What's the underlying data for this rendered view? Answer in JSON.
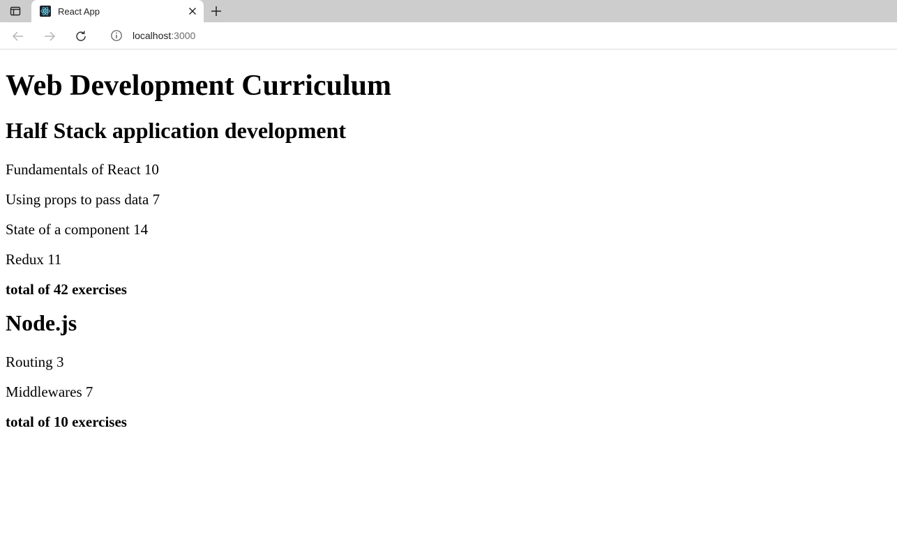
{
  "browser": {
    "tab_title": "React App",
    "url_host": "localhost",
    "url_port": ":3000"
  },
  "page": {
    "title": "Web Development Curriculum",
    "courses": [
      {
        "name": "Half Stack application development",
        "parts": [
          {
            "name": "Fundamentals of React",
            "exercises": 10
          },
          {
            "name": "Using props to pass data",
            "exercises": 7
          },
          {
            "name": "State of a component",
            "exercises": 14
          },
          {
            "name": "Redux",
            "exercises": 11
          }
        ],
        "total": "total of 42 exercises"
      },
      {
        "name": "Node.js",
        "parts": [
          {
            "name": "Routing",
            "exercises": 3
          },
          {
            "name": "Middlewares",
            "exercises": 7
          }
        ],
        "total": "total of 10 exercises"
      }
    ]
  }
}
